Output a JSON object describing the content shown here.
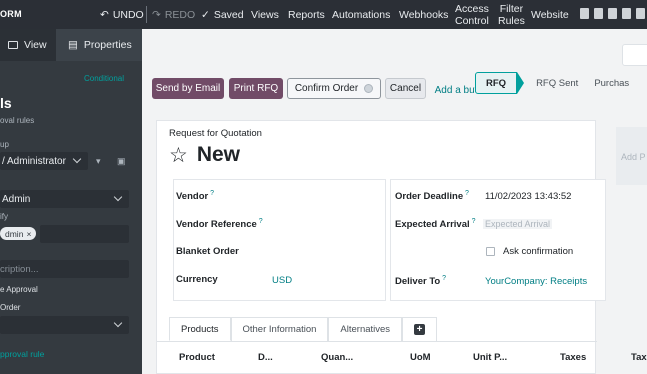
{
  "topbar": {
    "brand": "ORM",
    "undo": "UNDO",
    "redo": "REDO",
    "saved": "Saved",
    "menu": [
      "Views",
      "Reports",
      "Automations",
      "Webhooks"
    ],
    "access_control": [
      "Access",
      "Control"
    ],
    "filter_rules": [
      "Filter",
      "Rules"
    ],
    "website": "Website"
  },
  "sidebar": {
    "tab_view": "View",
    "tab_properties": "Properties",
    "conditional": "Conditional",
    "title": "ls",
    "subtitle": "oval rules",
    "group_label": "up",
    "group_value": "/ Administrator",
    "user_value": "Admin",
    "notify_label": "ify",
    "notify_tag": "dmin",
    "description_placeholder": "cription...",
    "approval_label": "e Approval",
    "order_label": "Order",
    "add_rule": "pproval rule"
  },
  "actions": {
    "send_email": "Send by Email",
    "print_rfq": "Print RFQ",
    "confirm_order": "Confirm Order",
    "cancel": "Cancel",
    "add_button": "Add a button"
  },
  "status": {
    "stages": [
      "RFQ",
      "RFQ Sent",
      "Purchas"
    ]
  },
  "form": {
    "doc_type": "Request for Quotation",
    "name": "New",
    "side_button": "Add P",
    "left": {
      "vendor": "Vendor",
      "vendor_reference": "Vendor Reference",
      "blanket_order": "Blanket Order",
      "currency": "Currency",
      "currency_value": "USD"
    },
    "right": {
      "order_deadline": "Order Deadline",
      "order_deadline_value": "11/02/2023 13:43:52",
      "expected_arrival": "Expected Arrival",
      "expected_arrival_placeholder": "Expected Arrival",
      "ask_confirmation": "Ask confirmation",
      "deliver_to": "Deliver To",
      "deliver_to_value": "YourCompany: Receipts"
    },
    "tabs": [
      "Products",
      "Other Information",
      "Alternatives"
    ],
    "columns": [
      "Product",
      "D...",
      "Quan...",
      "UoM",
      "Unit P...",
      "Taxes",
      "Tax"
    ]
  }
}
